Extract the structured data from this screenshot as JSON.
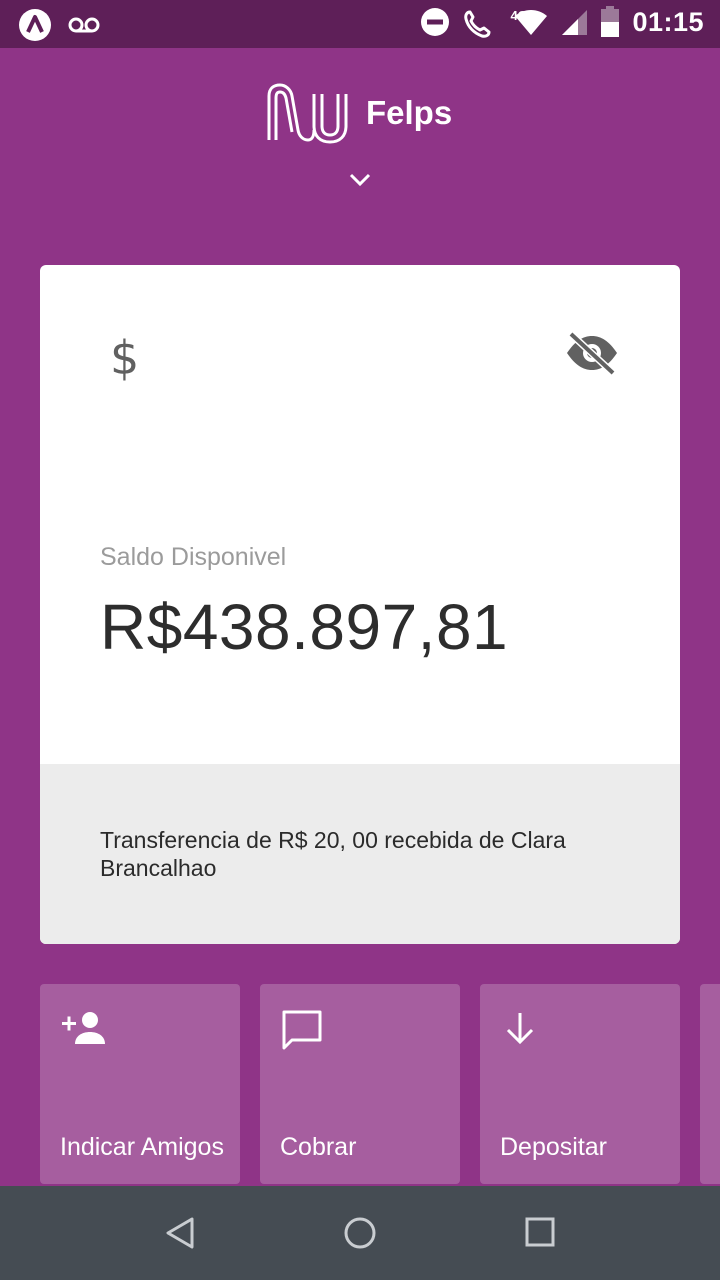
{
  "status_bar": {
    "time": "01:15",
    "network": "4G",
    "icons": [
      "nubank-notification-icon",
      "voicemail-icon",
      "do-not-disturb-icon",
      "wifi-calling-icon",
      "wifi-icon",
      "signal-icon",
      "battery-icon"
    ]
  },
  "header": {
    "brand_name": "Felps",
    "logo": "nu-logo"
  },
  "card": {
    "balance_label": "Saldo Disponivel",
    "balance_value": "R$438.897,81",
    "notice": "Transferencia de R$ 20, 00 recebida de Clara Brancalhao"
  },
  "actions": [
    {
      "label": "Indicar Amigos",
      "icon": "add-person-icon"
    },
    {
      "label": "Cobrar",
      "icon": "chat-bubble-icon"
    },
    {
      "label": "Depositar",
      "icon": "arrow-down-icon"
    }
  ],
  "nav": {
    "buttons": [
      "back-icon",
      "home-icon",
      "recents-icon"
    ]
  },
  "colors": {
    "background": "#8f3487",
    "status_bar": "#5e1f58",
    "action_tile": "#a65e9f",
    "nav_bar": "#454c53"
  }
}
